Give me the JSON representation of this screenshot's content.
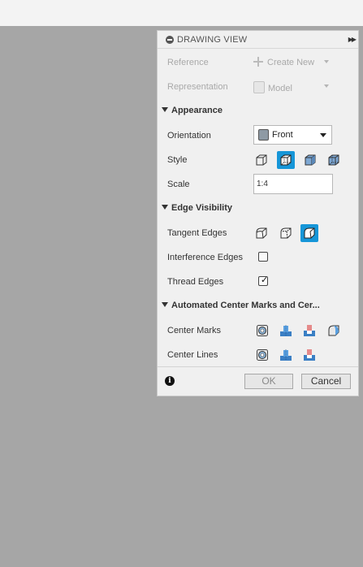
{
  "panel": {
    "title": "DRAWING VIEW",
    "reference": {
      "label": "Reference",
      "value": "Create New"
    },
    "representation": {
      "label": "Representation",
      "value": "Model"
    },
    "appearance": {
      "section": "Appearance",
      "orientation": {
        "label": "Orientation",
        "value": "Front"
      },
      "style": {
        "label": "Style",
        "options": [
          "visible-edges-icon",
          "visible-hidden-edges-icon",
          "shaded-icon",
          "shaded-hidden-edges-icon"
        ],
        "selected_index": 1
      },
      "scale": {
        "label": "Scale",
        "value": "1:4"
      }
    },
    "edge_visibility": {
      "section": "Edge Visibility",
      "tangent_edges": {
        "label": "Tangent Edges",
        "options": [
          "full-length-icon",
          "shortened-icon",
          "off-icon"
        ],
        "selected_index": 2
      },
      "interference_edges": {
        "label": "Interference Edges",
        "checked": false
      },
      "thread_edges": {
        "label": "Thread Edges",
        "checked": true
      }
    },
    "center_marks": {
      "section": "Automated Center Marks and Cer...",
      "center_marks": {
        "label": "Center Marks",
        "icons": [
          "hole-icon",
          "extrude-icon",
          "cut-icon",
          "fillet-icon"
        ]
      },
      "center_lines": {
        "label": "Center Lines",
        "icons": [
          "hole-icon",
          "extrude-icon",
          "cut-icon"
        ]
      }
    },
    "footer": {
      "ok_label": "OK",
      "cancel_label": "Cancel"
    }
  },
  "colors": {
    "accent": "#1696d8",
    "canvas": "#a6a6a6",
    "panel": "#f0f0f0"
  }
}
